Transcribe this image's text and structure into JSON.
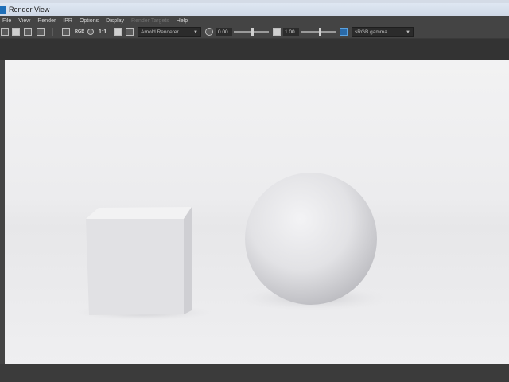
{
  "window": {
    "title": "Render View"
  },
  "menu": {
    "items": [
      {
        "label": "File",
        "enabled": true
      },
      {
        "label": "View",
        "enabled": true
      },
      {
        "label": "Render",
        "enabled": true
      },
      {
        "label": "IPR",
        "enabled": true
      },
      {
        "label": "Options",
        "enabled": true
      },
      {
        "label": "Display",
        "enabled": true
      },
      {
        "label": "Render Targets",
        "enabled": false
      },
      {
        "label": "Help",
        "enabled": true
      }
    ]
  },
  "toolbar": {
    "icons": [
      "render-frame-icon",
      "render-region-icon",
      "open-image-icon",
      "snapshot-icon",
      "keep-image-icon",
      "rgb-channel-icon",
      "alpha-channel-icon",
      "real-size-icon",
      "display-settings-icon",
      "histogram-icon"
    ],
    "rgb_label": "RGB",
    "real_size_label": "1:1",
    "renderer": "Arnold Renderer",
    "exposure_value": "0.00",
    "gamma_value": "1.00",
    "color_space": "sRGB gamma"
  },
  "viewport": {
    "scene_objects": [
      "cube",
      "sphere"
    ],
    "background_color": "#ececee",
    "object_color": "#e4e4e6"
  }
}
